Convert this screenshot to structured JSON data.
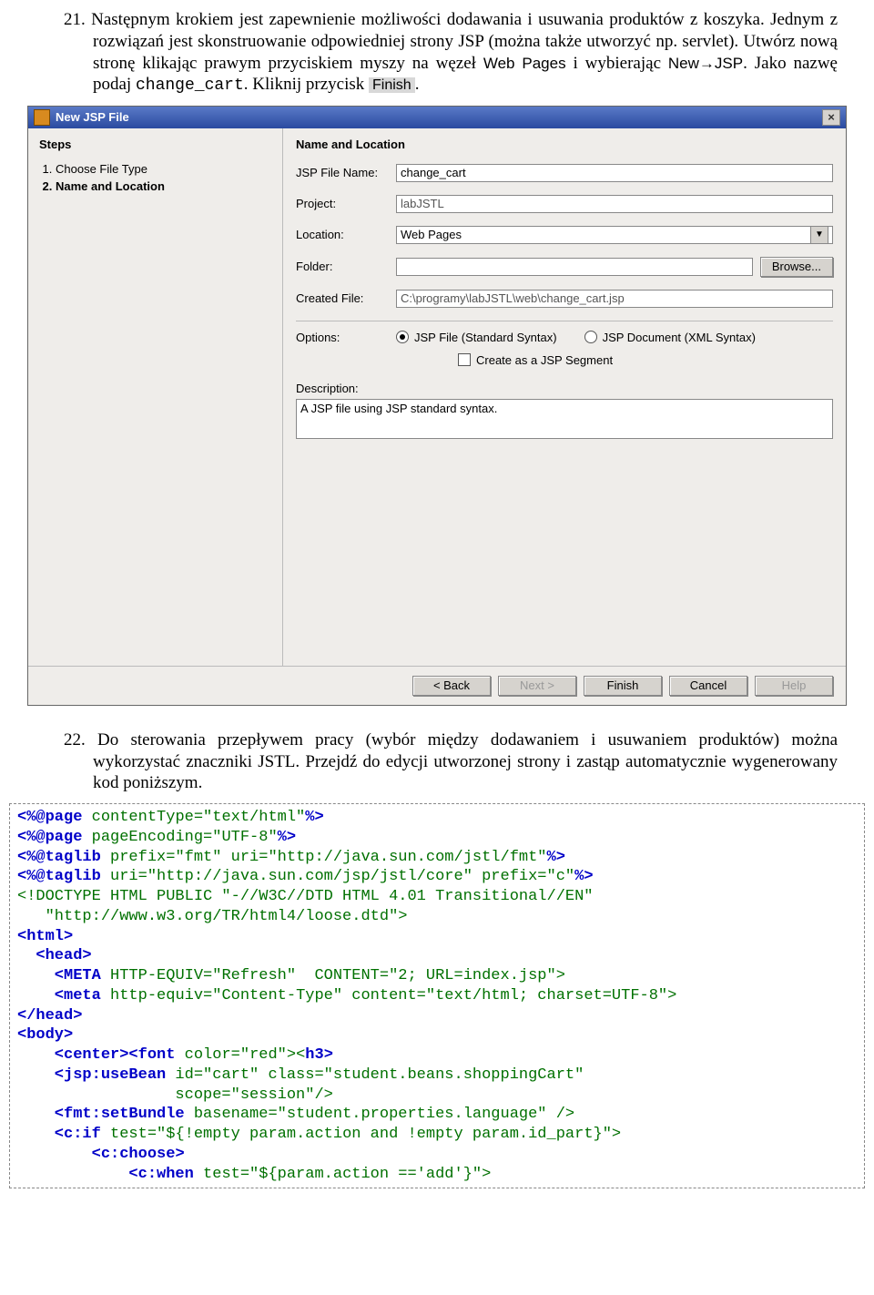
{
  "para21": {
    "num": "21.",
    "t1": "Następnym krokiem jest zapewnienie możliwości dodawania i usuwania produktów z koszyka. Jednym z rozwiązań jest skonstruowanie odpowiedniej strony JSP (można także utworzyć np. servlet). Utwórz nową stronę klikając prawym przyciskiem myszy na węzeł ",
    "webpages": "Web Pages",
    "t2": " i wybierając ",
    "newjsp": "New→JSP",
    "t3": ". Jako nazwę podaj ",
    "code": "change_cart",
    "t4": ". Kliknij przycisk ",
    "finish": "Finish",
    "t5": "."
  },
  "dialog": {
    "title": "New JSP File",
    "close": "×",
    "steps_header": "Steps",
    "steps": [
      "Choose File Type",
      "Name and Location"
    ],
    "active_step": 2,
    "form_header": "Name and Location",
    "labels": {
      "filename": "JSP File Name:",
      "project": "Project:",
      "location": "Location:",
      "folder": "Folder:",
      "created": "Created File:",
      "options": "Options:",
      "description": "Description:"
    },
    "values": {
      "filename": "change_cart",
      "project": "labJSTL",
      "location": "Web Pages",
      "folder": "",
      "created": "C:\\programy\\labJSTL\\web\\change_cart.jsp",
      "option1": "JSP File (Standard Syntax)",
      "option2": "JSP Document (XML Syntax)",
      "segment": "Create as a JSP Segment",
      "description": "A JSP file using JSP standard syntax."
    },
    "buttons": {
      "browse": "Browse...",
      "back": "< Back",
      "next": "Next >",
      "finish": "Finish",
      "cancel": "Cancel",
      "help": "Help"
    }
  },
  "para22": {
    "num": "22.",
    "text": "Do sterowania przepływem pracy (wybór między dodawaniem i usuwaniem produktów) można wykorzystać znaczniki JSTL. Przejdź do edycji utworzonej strony i zastąp automatycznie wygenerowany kod poniższym."
  },
  "code": {
    "l1a": "<%@page",
    "l1b": " contentType=\"text/html\"",
    "l1c": "%>",
    "l2a": "<%@page",
    "l2b": " pageEncoding=\"UTF-8\"",
    "l2c": "%>",
    "l3a": "<%@taglib",
    "l3b": " prefix=\"fmt\" uri=\"http://java.sun.com/jstl/fmt\"",
    "l3c": "%>",
    "l4a": "<%@taglib",
    "l4b": " uri=\"http://java.sun.com/jsp/jstl/core\" prefix=\"c\"",
    "l4c": "%>",
    "l5": "<!DOCTYPE HTML PUBLIC \"-//W3C//DTD HTML 4.01 Transitional//EN\"",
    "l6": "   \"http://www.w3.org/TR/html4/loose.dtd\">",
    "l7o": "<",
    "l7t": "html",
    "l7c": ">",
    "l8o": "  <",
    "l8t": "head",
    "l8c": ">",
    "l9o": "    <",
    "l9t": "META",
    "l9r": " HTTP-EQUIV=\"Refresh\"  CONTENT=\"2; URL=index.jsp\">",
    "l10o": "    <",
    "l10t": "meta",
    "l10r": " http-equiv=\"Content-Type\" content=\"text/html; charset=UTF-8\">",
    "l11o": "</",
    "l11t": "head",
    "l11c": ">",
    "l12o": "<",
    "l12t": "body",
    "l12c": ">",
    "l13o": "    <",
    "l13t1": "center",
    "l13m": "><",
    "l13t2": "font",
    "l13r": " color=\"red\"><",
    "l13t3": "h3",
    "l13c": ">",
    "l14o": "    <",
    "l14t": "jsp:useBean",
    "l14r": " id=\"cart\" class=\"student.beans.shoppingCart\"",
    "l15": "                 scope=\"session\"/>",
    "l16o": "    <",
    "l16t": "fmt:setBundle",
    "l16r": " basename=\"student.properties.language\" />",
    "l17o": "    <",
    "l17t": "c:if",
    "l17r": " test=\"${!empty param.action and !empty param.id_part}\">",
    "l18o": "        <",
    "l18t": "c:choose",
    "l18c": ">",
    "l19o": "            <",
    "l19t": "c:when",
    "l19r": " test=\"${param.action =='add'}\">"
  }
}
